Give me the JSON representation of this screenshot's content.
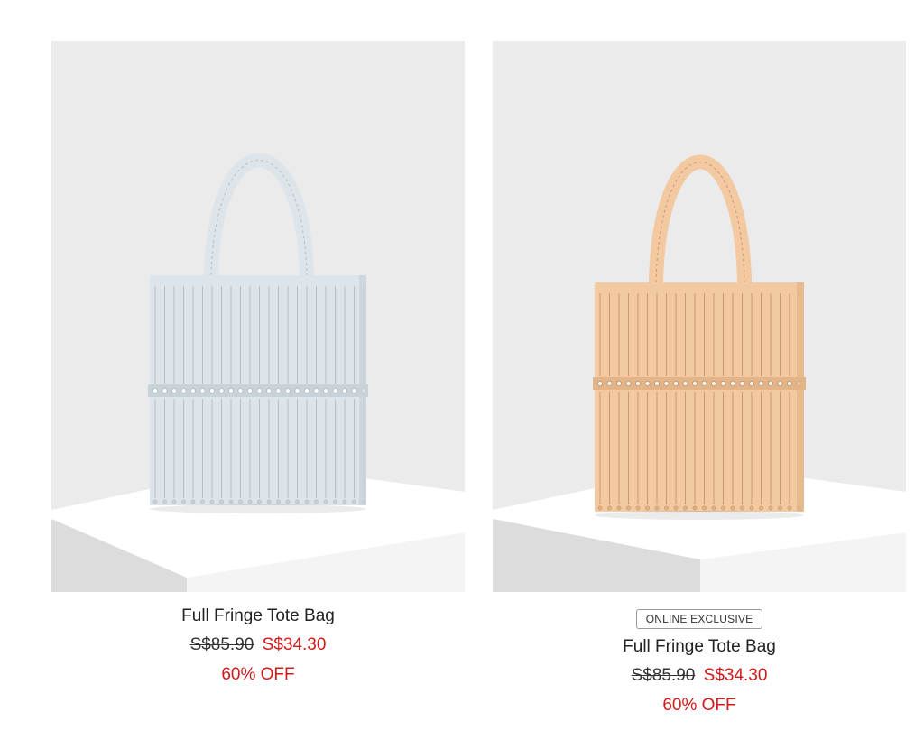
{
  "products": [
    {
      "name": "Full Fringe Tote Bag",
      "badge": "",
      "old_price": "S$85.90",
      "new_price": "S$34.30",
      "discount": "60% OFF",
      "bag_color": "#dde5ea",
      "bag_shade": "#c8d2d9",
      "bag_line": "#b4bfc7"
    },
    {
      "name": "Full Fringe Tote Bag",
      "badge": "ONLINE EXCLUSIVE",
      "old_price": "S$85.90",
      "new_price": "S$34.30",
      "discount": "60% OFF",
      "bag_color": "#f2c9a0",
      "bag_shade": "#e2b487",
      "bag_line": "#c99a6e"
    }
  ],
  "colors": {
    "sale_red": "#d11a1a",
    "backdrop": "#ebebeb",
    "pedestal_top": "#ffffff",
    "pedestal_side": "#d9d9d9"
  }
}
